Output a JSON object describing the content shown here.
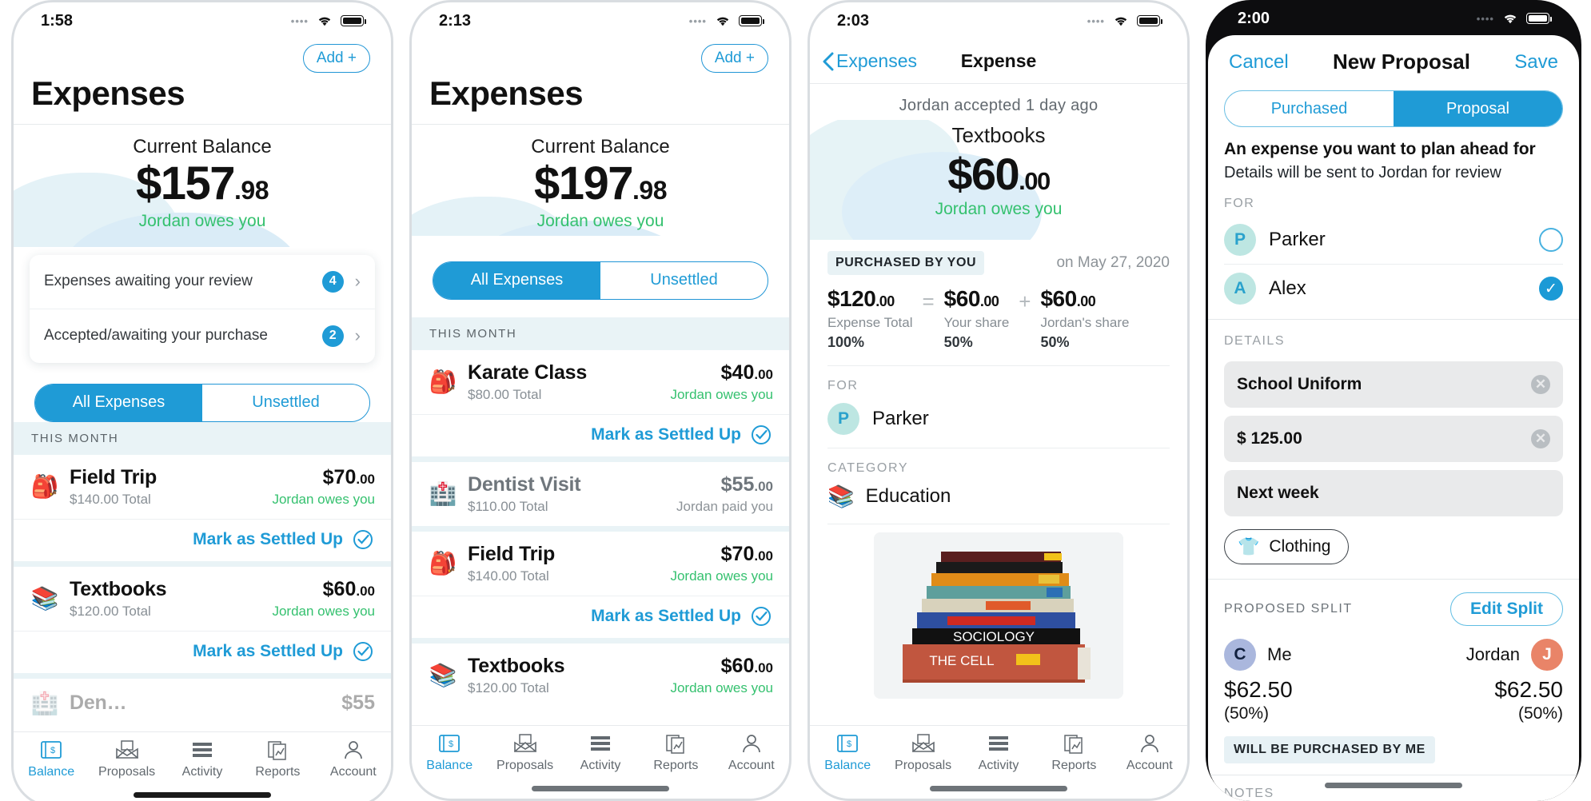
{
  "phone1": {
    "status": {
      "time": "1:58"
    },
    "add_button": "Add +",
    "title": "Expenses",
    "balance": {
      "label": "Current Balance",
      "dollars": "$157",
      "cents": ".98",
      "status": "Jordan owes you"
    },
    "review_card": [
      {
        "label": "Expenses awaiting your review",
        "count": "4"
      },
      {
        "label": "Accepted/awaiting your purchase",
        "count": "2"
      }
    ],
    "segments": [
      {
        "label": "All Expenses",
        "selected": true
      },
      {
        "label": "Unsettled",
        "selected": false
      }
    ],
    "section_header": "THIS MONTH",
    "items": [
      {
        "icon": "sports-icon",
        "emoji": "🎒",
        "name": "Field Trip",
        "total": "$140",
        "total_cents": ".00",
        "total_suffix": " Total",
        "amount": "$70",
        "amount_cents": ".00",
        "status": "Jordan owes you",
        "status_type": "green",
        "settle": "Mark as Settled Up"
      },
      {
        "icon": "education-icon",
        "emoji": "📚",
        "name": "Textbooks",
        "total": "$120",
        "total_cents": ".00",
        "total_suffix": " Total",
        "amount": "$60",
        "amount_cents": ".00",
        "status": "Jordan owes you",
        "status_type": "green",
        "settle": "Mark as Settled Up"
      }
    ],
    "tabs": [
      {
        "label": "Balance",
        "icon": "money-icon",
        "active": true
      },
      {
        "label": "Proposals",
        "icon": "envelope-icon",
        "active": false
      },
      {
        "label": "Activity",
        "icon": "list-icon",
        "active": false
      },
      {
        "label": "Reports",
        "icon": "report-icon",
        "active": false
      },
      {
        "label": "Account",
        "icon": "person-icon",
        "active": false
      }
    ]
  },
  "phone2": {
    "status": {
      "time": "2:13"
    },
    "add_button": "Add +",
    "title": "Expenses",
    "balance": {
      "label": "Current Balance",
      "dollars": "$197",
      "cents": ".98",
      "status": "Jordan owes you"
    },
    "segments": [
      {
        "label": "All Expenses",
        "selected": true
      },
      {
        "label": "Unsettled",
        "selected": false
      }
    ],
    "section_header": "THIS MONTH",
    "items": [
      {
        "icon": "sports-icon",
        "emoji": "🎒",
        "name": "Karate Class",
        "total": "$80",
        "total_cents": ".00",
        "total_suffix": " Total",
        "amount": "$40",
        "amount_cents": ".00",
        "status": "Jordan owes you",
        "status_type": "green",
        "settle": "Mark as Settled Up",
        "dim": false
      },
      {
        "icon": "medical-icon",
        "emoji": "🏥",
        "name": "Dentist Visit",
        "total": "$110",
        "total_cents": ".00",
        "total_suffix": " Total",
        "amount": "$55",
        "amount_cents": ".00",
        "status": "Jordan paid you",
        "status_type": "gray",
        "settle": "",
        "dim": true
      },
      {
        "icon": "sports-icon",
        "emoji": "🎒",
        "name": "Field Trip",
        "total": "$140",
        "total_cents": ".00",
        "total_suffix": " Total",
        "amount": "$70",
        "amount_cents": ".00",
        "status": "Jordan owes you",
        "status_type": "green",
        "settle": "Mark as Settled Up",
        "dim": false
      },
      {
        "icon": "education-icon",
        "emoji": "📚",
        "name": "Textbooks",
        "total": "$120",
        "total_cents": ".00",
        "total_suffix": " Total",
        "amount": "$60",
        "amount_cents": ".00",
        "status": "Jordan owes you",
        "status_type": "green",
        "settle": "",
        "dim": false
      }
    ],
    "tabs": [
      {
        "label": "Balance",
        "icon": "money-icon",
        "active": true
      },
      {
        "label": "Proposals",
        "icon": "envelope-icon",
        "active": false
      },
      {
        "label": "Activity",
        "icon": "list-icon",
        "active": false
      },
      {
        "label": "Reports",
        "icon": "report-icon",
        "active": false
      },
      {
        "label": "Account",
        "icon": "person-icon",
        "active": false
      }
    ]
  },
  "phone3": {
    "status": {
      "time": "2:03"
    },
    "nav": {
      "back": "Expenses",
      "title": "Expense"
    },
    "accepted_note": "Jordan accepted 1 day ago",
    "hero": {
      "title": "Textbooks",
      "dollars": "$60",
      "cents": ".00",
      "status": "Jordan owes you"
    },
    "purchased_pill": "PURCHASED BY YOU",
    "date": "on May 27, 2020",
    "split": [
      {
        "value": "$120",
        "cents": ".00",
        "key": "Expense Total",
        "pct": "100%"
      },
      {
        "value": "$60",
        "cents": ".00",
        "key": "Your share",
        "pct": "50%"
      },
      {
        "value": "$60",
        "cents": ".00",
        "key": "Jordan's share",
        "pct": "50%"
      }
    ],
    "ops": [
      "=",
      "+"
    ],
    "for_label": "FOR",
    "for_person": {
      "initial": "P",
      "name": "Parker"
    },
    "category_label": "CATEGORY",
    "category": {
      "emoji": "📚",
      "name": "Education"
    },
    "photo_alt": "stack-of-textbooks-photo",
    "tabs": [
      {
        "label": "Balance",
        "icon": "money-icon",
        "active": true
      },
      {
        "label": "Proposals",
        "icon": "envelope-icon",
        "active": false
      },
      {
        "label": "Activity",
        "icon": "list-icon",
        "active": false
      },
      {
        "label": "Reports",
        "icon": "report-icon",
        "active": false
      },
      {
        "label": "Account",
        "icon": "person-icon",
        "active": false
      }
    ]
  },
  "phone4": {
    "status": {
      "time": "2:00"
    },
    "nav": {
      "cancel": "Cancel",
      "title": "New Proposal",
      "save": "Save"
    },
    "segments": [
      {
        "label": "Purchased",
        "selected": false
      },
      {
        "label": "Proposal",
        "selected": true
      }
    ],
    "headline": "An expense you want to plan ahead for",
    "subline": "Details will be sent to Jordan for review",
    "for_label": "FOR",
    "people": [
      {
        "initial": "P",
        "name": "Parker",
        "selected": false
      },
      {
        "initial": "A",
        "name": "Alex",
        "selected": true
      }
    ],
    "details_label": "DETAILS",
    "fields": [
      {
        "name": "description-field",
        "value": "School Uniform"
      },
      {
        "name": "amount-field",
        "value": "$ 125.00"
      },
      {
        "name": "date-field",
        "value": "Next week"
      }
    ],
    "category_chip": {
      "emoji": "👕",
      "label": "Clothing"
    },
    "proposed_split_label": "PROPOSED SPLIT",
    "edit_split": "Edit Split",
    "split_people": [
      {
        "initial": "C",
        "name": "Me",
        "amount": "$62.50",
        "pct": "(50%)"
      },
      {
        "initial": "J",
        "name": "Jordan",
        "amount": "$62.50",
        "pct": "(50%)"
      }
    ],
    "will_purchase": "WILL BE PURCHASED BY ME",
    "notes_label": "NOTES"
  },
  "colors": {
    "accent_blue": "#1f9bd6",
    "green": "#35c16f",
    "section_bg": "#e9f3f6",
    "gray_field": "#e9eaeb"
  }
}
